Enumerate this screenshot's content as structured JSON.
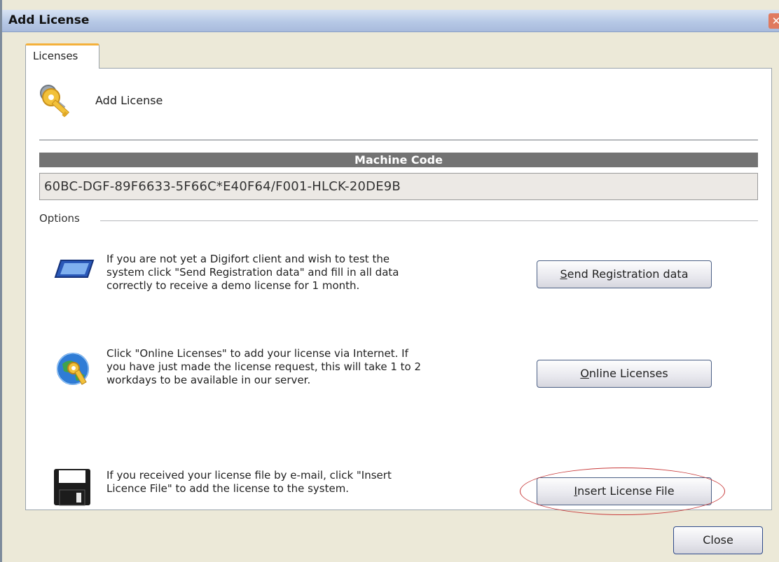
{
  "window": {
    "title": "Add License",
    "close_glyph": "✕"
  },
  "tabs": [
    {
      "label": "Licenses"
    }
  ],
  "header": {
    "label": "Add License",
    "icon": "keys-icon"
  },
  "machine_code": {
    "header": "Machine Code",
    "value": "60BC-DGF-89F6633-5F66C*E40F64/F001-HLCK-20DE9B"
  },
  "options": {
    "label": "Options",
    "items": [
      {
        "icon": "monitor-icon",
        "lines": [
          "If you are not yet a Digifort client and wish to test the",
          "system click \"Send Registration data\" and fill in all data",
          "correctly to receive a demo license for 1 month."
        ],
        "button_label": "Send Registration data",
        "accel": "S",
        "rest": "end Registration data"
      },
      {
        "icon": "globe-key-icon",
        "lines": [
          "Click \"Online Licenses\" to add your license via Internet. If",
          "you have just made the license request, this will take 1 to 2",
          "workdays to be available in our server."
        ],
        "button_label": "Online Licenses",
        "accel": "O",
        "rest": "nline Licenses"
      },
      {
        "icon": "floppy-disk-icon",
        "lines": [
          "If you received your license file by e-mail, click \"Insert",
          "Licence File\" to add the license to the system."
        ],
        "button_label": "Insert License File",
        "accel": "I",
        "rest": "nsert License File"
      }
    ]
  },
  "footer": {
    "close_label": "Close"
  },
  "colors": {
    "highlight_ring": "#c83a3a",
    "tab_accent": "#f4b13b",
    "machine_code_bar": "#737373"
  }
}
